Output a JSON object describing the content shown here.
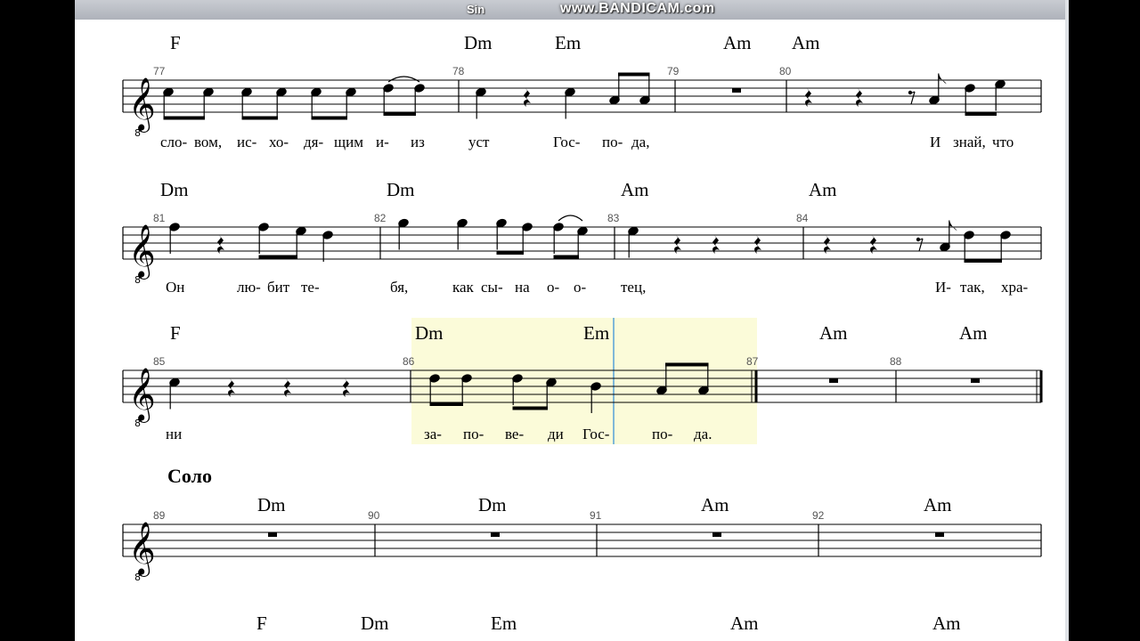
{
  "window": {
    "title_fragment": "Sin",
    "watermark": "www.BANDICAM.com"
  },
  "section_label": "Соло",
  "systems": [
    {
      "chords": [
        "F",
        "Dm",
        "Em",
        "Am",
        "Am"
      ],
      "measure_numbers": [
        "77",
        "78",
        "79",
        "80"
      ],
      "lyrics": [
        "сло-",
        "вом,",
        "ис-",
        "хо-",
        "дя-",
        "щим",
        "и-",
        "из",
        "уст",
        "Гос-",
        "по-",
        "да,",
        "И",
        "знай,",
        "что"
      ]
    },
    {
      "chords": [
        "Dm",
        "Dm",
        "Am",
        "Am"
      ],
      "measure_numbers": [
        "81",
        "82",
        "83",
        "84"
      ],
      "lyrics": [
        "Он",
        "лю-",
        "бит",
        "те-",
        "бя,",
        "как",
        "сы-",
        "на",
        "о-",
        "о-",
        "тец,",
        "И-",
        "так,",
        "хра-"
      ]
    },
    {
      "chords": [
        "F",
        "Dm",
        "Em",
        "Am",
        "Am"
      ],
      "measure_numbers": [
        "85",
        "86",
        "87",
        "88"
      ],
      "lyrics": [
        "ни",
        "за-",
        "по-",
        "ве-",
        "ди",
        "Гос-",
        "по-",
        "да."
      ]
    },
    {
      "chords": [
        "Dm",
        "Dm",
        "Am",
        "Am"
      ],
      "measure_numbers": [
        "89",
        "90",
        "91",
        "92"
      ],
      "lyrics": []
    },
    {
      "chords": [
        "F",
        "Dm",
        "Em",
        "Am",
        "Am"
      ],
      "measure_numbers": [],
      "lyrics": []
    }
  ]
}
